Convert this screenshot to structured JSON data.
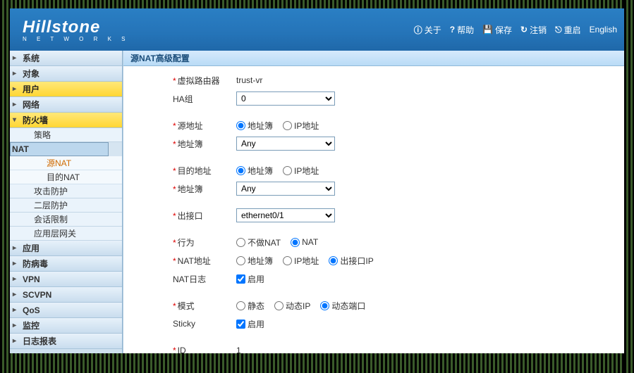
{
  "brand": {
    "name": "Hillstone",
    "sub": "N E T W O R K S"
  },
  "toplinks": {
    "about": "关于",
    "help": "帮助",
    "save": "保存",
    "logout": "注销",
    "reboot": "重启",
    "lang": "English"
  },
  "nav": {
    "system": "系统",
    "object": "对象",
    "user": "用户",
    "network": "网络",
    "firewall": "防火墙",
    "policy": "策略",
    "nat": "NAT",
    "snat": "源NAT",
    "dnat": "目的NAT",
    "atkdef": "攻击防护",
    "l2def": "二层防护",
    "sesslimit": "会话限制",
    "algw": "应用层网关",
    "app": "应用",
    "av": "防病毒",
    "vpn": "VPN",
    "scvpn": "SCVPN",
    "qos": "QoS",
    "monitor": "监控",
    "log": "日志报表"
  },
  "panel": {
    "title": "源NAT高级配置"
  },
  "form": {
    "vr_label": "虚拟路由器",
    "vr_value": "trust-vr",
    "ha_label": "HA组",
    "ha_value": "0",
    "srcaddr_label": "源地址",
    "addrbook_label": "地址簿",
    "radio_addrbook": "地址簿",
    "radio_ip": "IP地址",
    "any": "Any",
    "dstaddr_label": "目的地址",
    "egress_label": "出接口",
    "egress_value": "ethernet0/1",
    "action_label": "行为",
    "action_no": "不做NAT",
    "action_nat": "NAT",
    "nataddr_label": "NAT地址",
    "nataddr_out": "出接口IP",
    "natlog_label": "NAT日志",
    "enable": "启用",
    "mode_label": "模式",
    "mode_static": "静态",
    "mode_dynip": "动态IP",
    "mode_dynport": "动态端口",
    "sticky_label": "Sticky",
    "id_label": "ID",
    "id_value": "1"
  }
}
